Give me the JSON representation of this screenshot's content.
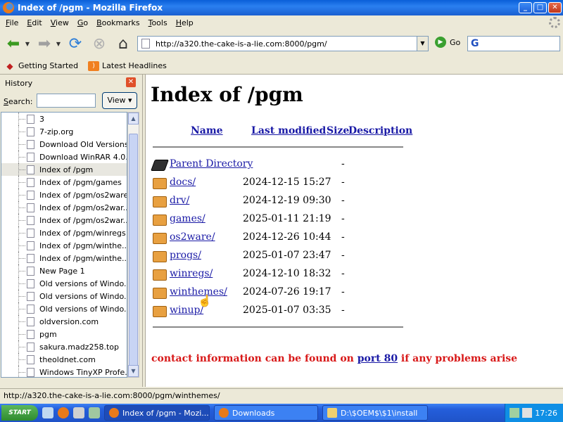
{
  "window": {
    "title": "Index of /pgm - Mozilla Firefox",
    "controls": [
      "_",
      "□",
      "✕"
    ]
  },
  "menu": [
    "File",
    "Edit",
    "View",
    "Go",
    "Bookmarks",
    "Tools",
    "Help"
  ],
  "toolbar": {
    "url": "http://a320.the-cake-is-a-lie.com:8000/pgm/",
    "go_label": "Go",
    "search_placeholder": ""
  },
  "bookmarks": [
    {
      "label": "Getting Started",
      "icon": "firefox-icon"
    },
    {
      "label": "Latest Headlines",
      "icon": "rss-icon"
    }
  ],
  "sidebar": {
    "title": "History",
    "search_label": "Search:",
    "search_value": "",
    "view_label": "View ▾",
    "items": [
      "3",
      "7-zip.org",
      "Download Old Versions...",
      "Download WinRAR 4.0...",
      "Index of /pgm",
      "Index of /pgm/games",
      "Index of /pgm/os2ware",
      "Index of /pgm/os2war...",
      "Index of /pgm/os2war...",
      "Index of /pgm/winregs",
      "Index of /pgm/winthe...",
      "Index of /pgm/winthe...",
      "New Page 1",
      "Old versions of Windo...",
      "Old versions of Windo...",
      "Old versions of Windo...",
      "oldversion.com",
      "pgm",
      "sakura.madz258.top",
      "theoldnet.com",
      "Windows TinyXP Profe..."
    ],
    "selected_index": 4
  },
  "page": {
    "heading": "Index of /pgm",
    "columns": {
      "name": "Name",
      "modified": "Last modified",
      "size": "Size",
      "description": "Description"
    },
    "parent": {
      "name": "Parent Directory",
      "size": "-"
    },
    "rows": [
      {
        "name": "docs/",
        "modified": "2024-12-15 15:27",
        "size": "-"
      },
      {
        "name": "drv/",
        "modified": "2024-12-19 09:30",
        "size": "-"
      },
      {
        "name": "games/",
        "modified": "2025-01-11 21:19",
        "size": "-"
      },
      {
        "name": "os2ware/",
        "modified": "2024-12-26 10:44",
        "size": "-"
      },
      {
        "name": "progs/",
        "modified": "2025-01-07 23:47",
        "size": "-"
      },
      {
        "name": "winregs/",
        "modified": "2024-12-10 18:32",
        "size": "-"
      },
      {
        "name": "winthemes/",
        "modified": "2024-07-26 19:17",
        "size": "-"
      },
      {
        "name": "winup/",
        "modified": "2025-01-07 03:35",
        "size": "-"
      }
    ],
    "footer_before": "contact information can be found on ",
    "footer_link": "port 80",
    "footer_after": " if any problems arise"
  },
  "status": {
    "text": "http://a320.the-cake-is-a-lie.com:8000/pgm/winthemes/"
  },
  "taskbar": {
    "start": "START",
    "tasks": [
      {
        "label": "Index of /pgm - Mozi...",
        "active": true
      },
      {
        "label": "Downloads",
        "active": false
      },
      {
        "label": "D:\\$OEM$\\$1\\install",
        "active": false
      }
    ],
    "clock": "17:26"
  }
}
